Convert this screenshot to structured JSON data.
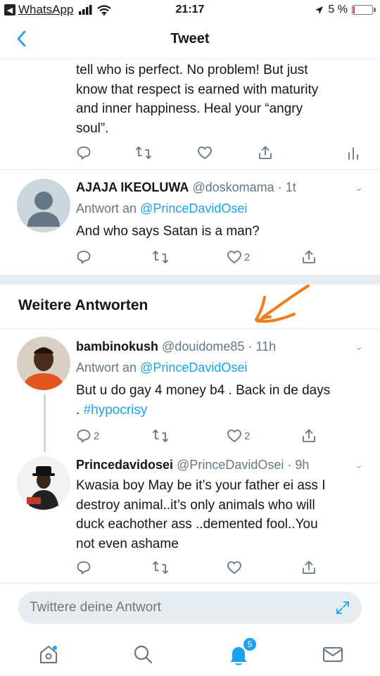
{
  "status_bar": {
    "back_app": "WhatsApp",
    "time": "21:17",
    "battery_text": "5 %",
    "battery_level": 0.05
  },
  "header": {
    "title": "Tweet"
  },
  "main_tweet": {
    "lines": [
      "tell who is perfect. No problem! But just",
      "know that respect is earned with maturity",
      "and inner happiness. Heal your “angry",
      "soul”."
    ]
  },
  "replies": [
    {
      "name": "AJAJA IKEOLUWA",
      "handle": "@doskomama",
      "time": "· 1t",
      "reply_prefix": "Antwort an ",
      "reply_to": "@PrinceDavidOsei",
      "text": "And who says Satan is a man?",
      "like_count": "2"
    }
  ],
  "section": {
    "title": "Weitere Antworten"
  },
  "more_replies": [
    {
      "name": "bambinokush",
      "handle": "@douidome85",
      "time": "· 11h",
      "reply_prefix": "Antwort an ",
      "reply_to": "@PrinceDavidOsei",
      "text_line1": "But u do gay 4 money b4 . Back in de days",
      "text_line2_prefix": ". ",
      "hashtag": "#hypocrisy",
      "reply_count": "2",
      "like_count": "2"
    },
    {
      "name": "Princedavidosei",
      "handle": "@PrinceDavidOsei",
      "time": "· 9h",
      "lines": [
        "Kwasia boy May be it’s your father ei ass I",
        "destroy animal..it’s only animals who will",
        "duck eachother ass ..demented fool..You",
        "not even ashame"
      ]
    }
  ],
  "compose": {
    "placeholder": "Twittere deine Antwort"
  },
  "nav": {
    "notifications_badge": "5"
  },
  "colors": {
    "accent": "#1da1f2",
    "muted": "#657786",
    "divider": "#e6ecf0",
    "annotation": "#f07c1e"
  }
}
